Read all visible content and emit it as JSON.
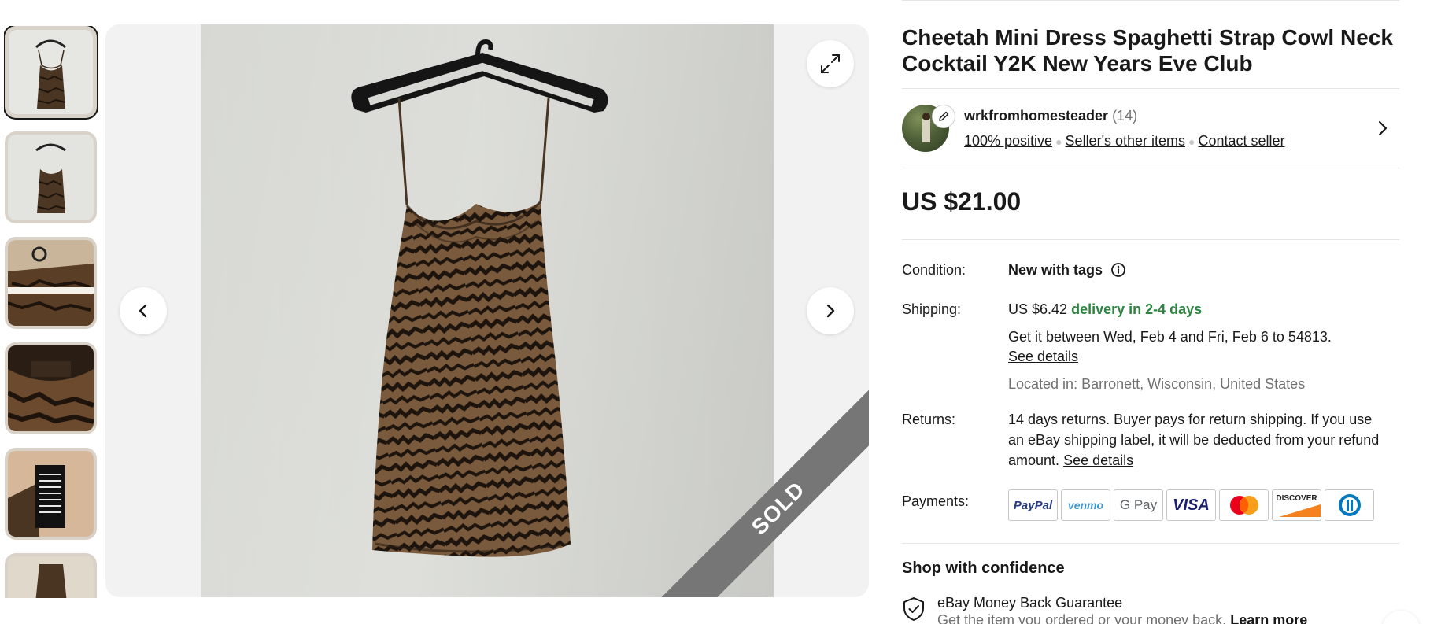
{
  "listing": {
    "title": "Cheetah Mini Dress Spaghetti Strap Cowl Neck Cocktail Y2K New Years Eve Club",
    "price": "US $21.00",
    "sold_banner": "SOLD"
  },
  "gallery": {
    "thumbnail_count": 6,
    "active_index": 0
  },
  "seller": {
    "name": "wrkfromhomesteader",
    "count": "(14)",
    "feedback_link": "100% positive",
    "other_items_link": "Seller's other items",
    "contact_link": "Contact seller"
  },
  "condition": {
    "label": "Condition:",
    "value": "New with tags"
  },
  "shipping": {
    "label": "Shipping:",
    "price": "US $6.42",
    "speed": "delivery in 2-4 days",
    "dates": "Get it between Wed, Feb 4 and Fri, Feb 6 to 54813.",
    "details_link": "See details",
    "location": "Located in: Barronett, Wisconsin, United States"
  },
  "returns": {
    "label": "Returns:",
    "text": "14 days returns. Buyer pays for return shipping. If you use an eBay shipping label, it will be deducted from your refund amount.",
    "details_link": "See details"
  },
  "payments": {
    "label": "Payments:",
    "methods": [
      "PayPal",
      "venmo",
      "G Pay",
      "VISA",
      "Mastercard",
      "DISCOVER",
      "Diners Club"
    ]
  },
  "confidence": {
    "title": "Shop with confidence",
    "guarantee_title": "eBay Money Back Guarantee",
    "guarantee_text": "Get the item you ordered or your money back.",
    "learn_more": "Learn more"
  },
  "colors": {
    "text": "#191919",
    "muted": "#707070",
    "success": "#2e8540",
    "sold_band": "#767676"
  }
}
